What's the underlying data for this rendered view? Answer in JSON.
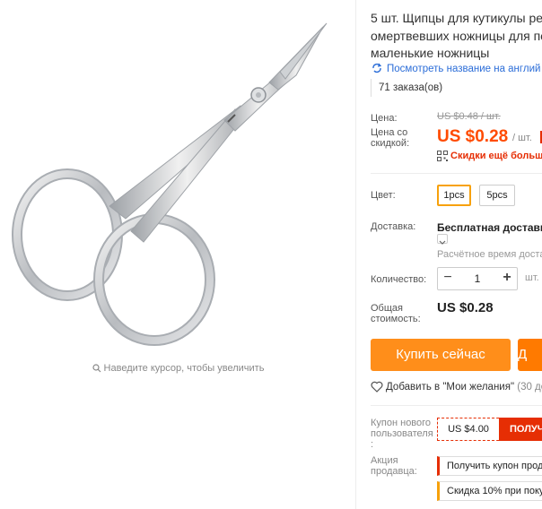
{
  "gallery": {
    "image_alt": "Cuticle scissors",
    "zoom_hint": "Наведите курсор, чтобы увеличить"
  },
  "product": {
    "title_line1": "5 шт. Щипцы для кутикулы рез",
    "title_line2": "омертвевших ножницы для пе",
    "title_line3": "маленькие ножницы",
    "translate_link": "Посмотреть название на англий",
    "orders": "71 заказа(ов)"
  },
  "price": {
    "price_label": "Цена:",
    "old_price": "US $0.48 / шт.",
    "discount_label_line1": "Цена со",
    "discount_label_line2": "скидкой:",
    "current_price": "US $0.28",
    "per_unit": "/ шт.",
    "more_discounts": "Скидки ещё больше"
  },
  "options": {
    "color_label": "Цвет:",
    "sku_1": "1pcs",
    "sku_2": "5pcs",
    "selected": "1pcs"
  },
  "delivery": {
    "label": "Доставка:",
    "title": "Бесплатная доставка",
    "estimate": "Расчётное время доставк"
  },
  "quantity": {
    "label": "Количество:",
    "minus": "−",
    "value": "1",
    "plus": "+",
    "unit": "шт."
  },
  "total": {
    "label_line1": "Общая",
    "label_line2": "стоимость:",
    "value": "US $0.28"
  },
  "actions": {
    "buy_now": "Купить сейчас",
    "add_to_cart": "Д"
  },
  "wishlist": {
    "label": "Добавить в \"Мои желания\"",
    "count": "(30 до"
  },
  "coupons": {
    "new_user_label_line1": "Купон нового",
    "new_user_label_line2": "пользователя",
    "new_user_label_line3": ":",
    "coupon_value": "US $4.00",
    "coupon_action": "ПОЛУЧ",
    "seller_label_line1": "Акция",
    "seller_label_line2": "продавца:",
    "seller_promo_1": "Получить купон прод",
    "seller_promo_2": "Скидка 10% при поку"
  },
  "colors": {
    "accent_orange": "#ff8e1a",
    "price_red": "#ff4b00",
    "promo_red": "#e62e04",
    "link_blue": "#2b6dd8",
    "selected_border": "#f7a10b"
  }
}
